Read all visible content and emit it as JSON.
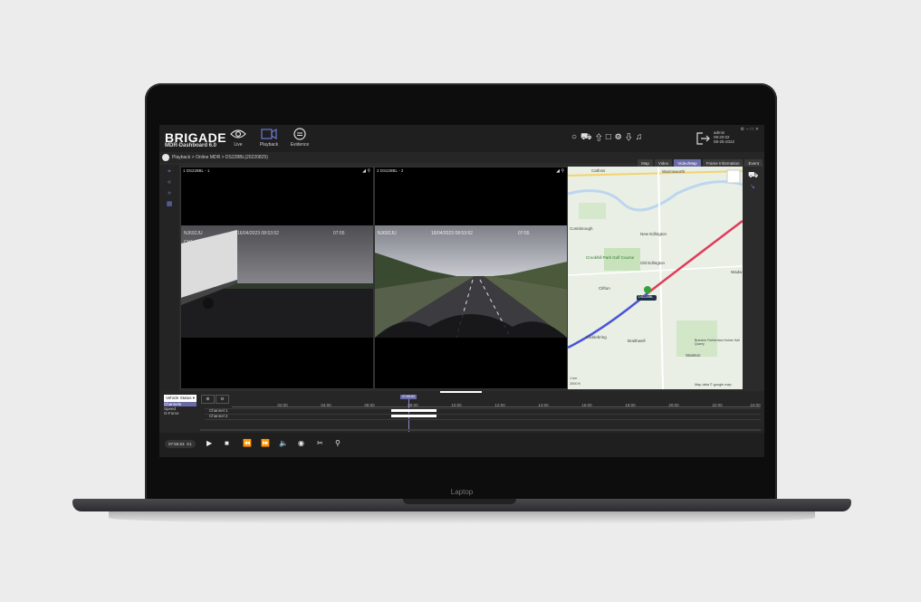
{
  "app": {
    "logo": "BRIGADE",
    "subtitle": "MDR-Dashboard 6.0"
  },
  "nav": [
    {
      "label": "Live",
      "icon": "eye-icon"
    },
    {
      "label": "Playback",
      "icon": "video-camera-icon"
    },
    {
      "label": "Evidence",
      "icon": "chat-bubble-icon"
    }
  ],
  "user": {
    "name": "admin",
    "time": "09:20:02",
    "date": "08-25-2022"
  },
  "breadcrumb": "Playback > Online MDR > DS228BL(20220825)",
  "view_tabs": [
    {
      "label": "Map",
      "active": false
    },
    {
      "label": "Video",
      "active": false
    },
    {
      "label": "Video/Map",
      "active": true
    },
    {
      "label": "Frame Information",
      "active": false
    },
    {
      "label": "Event",
      "active": false
    }
  ],
  "videos": [
    {
      "label": "1 DS228BL - 1",
      "overlay_left": "NJ692JU",
      "overlay_mid": "16/04/2023 08:53:52",
      "overlay_right": "07:55",
      "overlay_ch": "CH1"
    },
    {
      "label": "2 DS228BL - 2",
      "overlay_left": "NJ692JU",
      "overlay_mid": "16/04/2023 08:53:52",
      "overlay_right": "07:55",
      "overlay_ch": ""
    }
  ],
  "map": {
    "places": [
      "Catfoss",
      "Warmsworth",
      "Conisbrough",
      "New Edlington",
      "Crookhill Park Golf Course",
      "Old Edlington",
      "Clifton",
      "Micklebring",
      "Braithwell",
      "Stainton",
      "Wadw",
      "Brandon Rotherham Hulme Hall Quarry"
    ],
    "marker": "DS228BL",
    "scale": "1 km",
    "scale2": "2000 ft",
    "attribution": "Map data © google map"
  },
  "timeline": {
    "dropdown": "Vehicle Status",
    "status_items": [
      "Channels",
      "Speed",
      "G-Force"
    ],
    "selected_status": "Channels",
    "ticks": [
      "02:00",
      "04:00",
      "06:00",
      "08:00",
      "10:00",
      "12:00",
      "14:00",
      "16:00",
      "18:00",
      "20:00",
      "22:00",
      "24:00"
    ],
    "cursor": "07:55:53",
    "channels": [
      "Channel 1",
      "Channel 2"
    ]
  },
  "playback": {
    "clock": "07:55:53",
    "speed": "X1"
  },
  "device_label": "Laptop"
}
